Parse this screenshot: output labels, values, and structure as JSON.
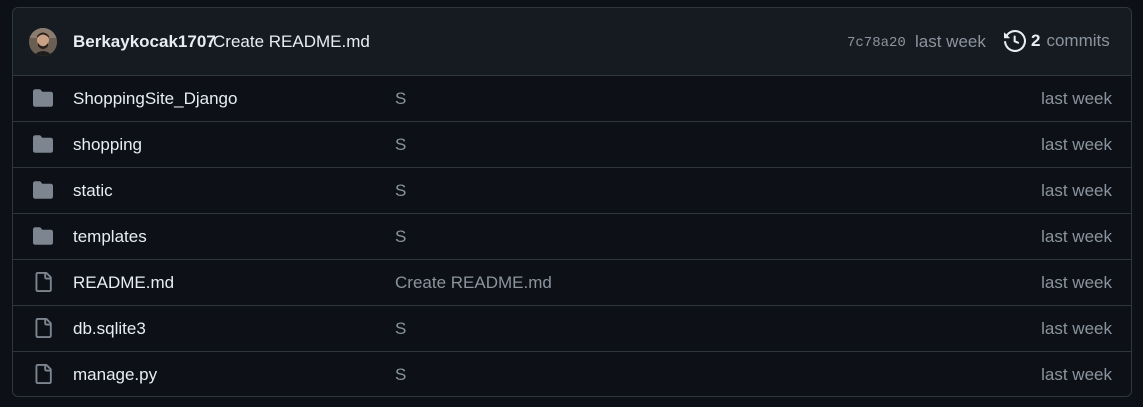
{
  "latest_commit": {
    "author": "Berkaykocak1707",
    "message": "Create README.md",
    "sha": "7c78a20",
    "time": "last week",
    "commit_count": "2",
    "commit_word": "commits"
  },
  "files": [
    {
      "name": "ShoppingSite_Django",
      "type": "folder",
      "message": "S",
      "time": "last week"
    },
    {
      "name": "shopping",
      "type": "folder",
      "message": "S",
      "time": "last week"
    },
    {
      "name": "static",
      "type": "folder",
      "message": "S",
      "time": "last week"
    },
    {
      "name": "templates",
      "type": "folder",
      "message": "S",
      "time": "last week"
    },
    {
      "name": "README.md",
      "type": "file",
      "message": "Create README.md",
      "time": "last week"
    },
    {
      "name": "db.sqlite3",
      "type": "file",
      "message": "S",
      "time": "last week"
    },
    {
      "name": "manage.py",
      "type": "file",
      "message": "S",
      "time": "last week"
    }
  ],
  "colors": {
    "background": "#0d1117",
    "header_bg": "#161b22",
    "border": "#30363d",
    "text": "#e6edf3",
    "muted": "#8b949e"
  }
}
